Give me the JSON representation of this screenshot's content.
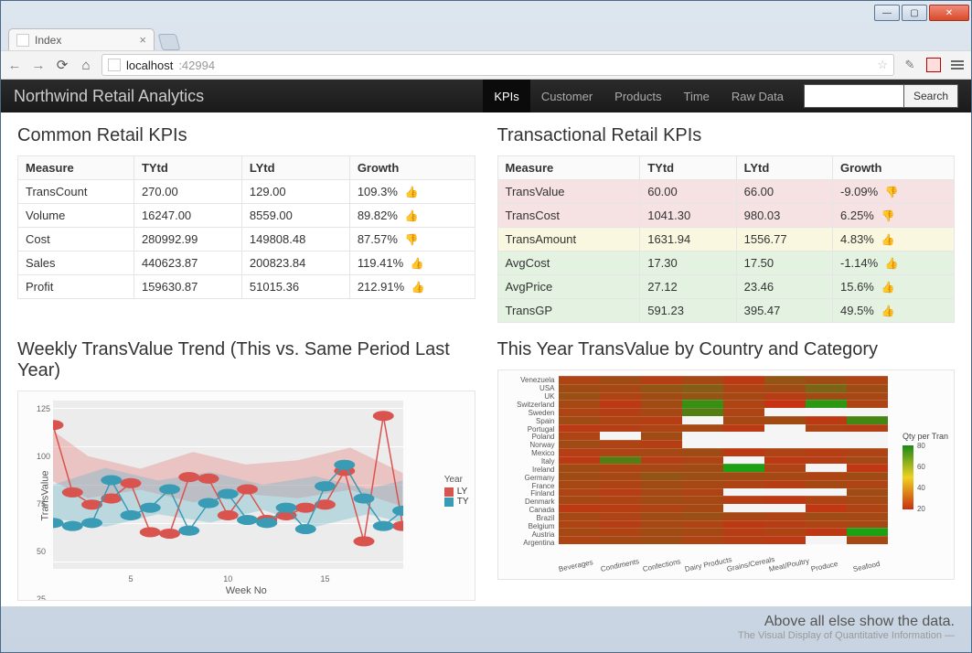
{
  "window": {
    "tab_title": "Index",
    "url_host": "localhost",
    "url_port": ":42994"
  },
  "navbar": {
    "brand": "Northwind Retail Analytics",
    "links": [
      "KPIs",
      "Customer",
      "Products",
      "Time",
      "Raw Data"
    ],
    "active_index": 0,
    "search_button": "Search",
    "search_placeholder": ""
  },
  "sections": {
    "common_title": "Common Retail KPIs",
    "trans_title": "Transactional Retail KPIs",
    "weekly_title": "Weekly TransValue Trend (This vs. Same Period Last Year)",
    "country_title": "This Year TransValue by Country and Category"
  },
  "common_table": {
    "headers": [
      "Measure",
      "TYtd",
      "LYtd",
      "Growth"
    ],
    "rows": [
      {
        "measure": "TransCount",
        "tytd": "270.00",
        "lytd": "129.00",
        "growth": "109.3%",
        "icon": "up"
      },
      {
        "measure": "Volume",
        "tytd": "16247.00",
        "lytd": "8559.00",
        "growth": "89.82%",
        "icon": "up"
      },
      {
        "measure": "Cost",
        "tytd": "280992.99",
        "lytd": "149808.48",
        "growth": "87.57%",
        "icon": "down"
      },
      {
        "measure": "Sales",
        "tytd": "440623.87",
        "lytd": "200823.84",
        "growth": "119.41%",
        "icon": "up"
      },
      {
        "measure": "Profit",
        "tytd": "159630.87",
        "lytd": "51015.36",
        "growth": "212.91%",
        "icon": "up"
      }
    ]
  },
  "trans_table": {
    "headers": [
      "Measure",
      "TYtd",
      "LYtd",
      "Growth"
    ],
    "rows": [
      {
        "measure": "TransValue",
        "tytd": "60.00",
        "lytd": "66.00",
        "growth": "-9.09%",
        "icon": "down",
        "tone": "red"
      },
      {
        "measure": "TransCost",
        "tytd": "1041.30",
        "lytd": "980.03",
        "growth": "6.25%",
        "icon": "down",
        "tone": "red"
      },
      {
        "measure": "TransAmount",
        "tytd": "1631.94",
        "lytd": "1556.77",
        "growth": "4.83%",
        "icon": "up",
        "tone": "yellow"
      },
      {
        "measure": "AvgCost",
        "tytd": "17.30",
        "lytd": "17.50",
        "growth": "-1.14%",
        "icon": "up",
        "tone": "green"
      },
      {
        "measure": "AvgPrice",
        "tytd": "27.12",
        "lytd": "23.46",
        "growth": "15.6%",
        "icon": "up",
        "tone": "green"
      },
      {
        "measure": "TransGP",
        "tytd": "591.23",
        "lytd": "395.47",
        "growth": "49.5%",
        "icon": "up",
        "tone": "green"
      }
    ]
  },
  "chart_data": [
    {
      "type": "line",
      "title": "Weekly TransValue Trend (This vs. Same Period Last Year)",
      "xlabel": "Week No",
      "ylabel": "TransValue",
      "x": [
        1,
        2,
        3,
        4,
        5,
        6,
        7,
        8,
        9,
        10,
        11,
        12,
        13,
        14,
        15,
        16,
        17,
        18,
        19
      ],
      "series": [
        {
          "name": "LY",
          "color": "#d9534f",
          "values": [
            114,
            70,
            62,
            66,
            76,
            44,
            43,
            80,
            79,
            55,
            72,
            52,
            55,
            60,
            62,
            84,
            38,
            120,
            48
          ]
        },
        {
          "name": "TY",
          "color": "#3a9bb5",
          "values": [
            50,
            48,
            50,
            78,
            55,
            60,
            72,
            45,
            63,
            69,
            52,
            50,
            60,
            46,
            74,
            88,
            66,
            48,
            58
          ]
        }
      ],
      "xticks": [
        5,
        10,
        15
      ],
      "yticks": [
        25,
        50,
        75,
        100,
        125
      ],
      "ylim": [
        20,
        130
      ]
    },
    {
      "type": "heatmap",
      "title": "This Year TransValue by Country and Category",
      "legend_title": "Qty per Tran",
      "legend_ticks": [
        20,
        40,
        60,
        80
      ],
      "y_categories": [
        "Venezuela",
        "USA",
        "UK",
        "Switzerland",
        "Sweden",
        "Spain",
        "Portugal",
        "Poland",
        "Norway",
        "Mexico",
        "Italy",
        "Ireland",
        "Germany",
        "France",
        "Finland",
        "Denmark",
        "Canada",
        "Brazil",
        "Belgium",
        "Austria",
        "Argentina"
      ],
      "x_categories": [
        "Beverages",
        "Condiments",
        "Confections",
        "Dairy Products",
        "Grains/Cereals",
        "Meat/Poultry",
        "Produce",
        "Seafood"
      ],
      "values": [
        [
          25,
          30,
          22,
          28,
          20,
          35,
          30,
          25
        ],
        [
          30,
          28,
          35,
          40,
          25,
          30,
          45,
          30
        ],
        [
          32,
          25,
          30,
          35,
          28,
          22,
          30,
          28
        ],
        [
          28,
          20,
          30,
          70,
          25,
          15,
          75,
          25
        ],
        [
          25,
          22,
          28,
          60,
          25,
          null,
          null,
          null
        ],
        [
          30,
          25,
          22,
          null,
          28,
          30,
          20,
          65
        ],
        [
          20,
          22,
          25,
          28,
          20,
          null,
          25,
          22
        ],
        [
          25,
          null,
          30,
          null,
          null,
          null,
          null,
          null
        ],
        [
          30,
          25,
          22,
          null,
          null,
          null,
          null,
          null
        ],
        [
          22,
          25,
          28,
          30,
          20,
          25,
          22,
          25
        ],
        [
          20,
          60,
          22,
          25,
          null,
          20,
          22,
          28
        ],
        [
          30,
          25,
          28,
          30,
          80,
          25,
          null,
          18
        ],
        [
          30,
          28,
          35,
          32,
          30,
          28,
          25,
          30
        ],
        [
          28,
          25,
          30,
          28,
          25,
          22,
          28,
          25
        ],
        [
          25,
          22,
          28,
          25,
          null,
          null,
          null,
          30
        ],
        [
          28,
          25,
          30,
          28,
          22,
          20,
          25,
          28
        ],
        [
          20,
          22,
          25,
          28,
          null,
          null,
          18,
          25
        ],
        [
          28,
          25,
          30,
          32,
          28,
          25,
          30,
          28
        ],
        [
          25,
          22,
          28,
          25,
          20,
          22,
          25,
          28
        ],
        [
          28,
          25,
          30,
          28,
          22,
          25,
          20,
          80
        ],
        [
          25,
          28,
          30,
          25,
          22,
          20,
          null,
          28
        ]
      ]
    }
  ],
  "footer": {
    "line1": "Above all else show the data.",
    "line2": "The Visual Display of Quantitative Information —"
  }
}
